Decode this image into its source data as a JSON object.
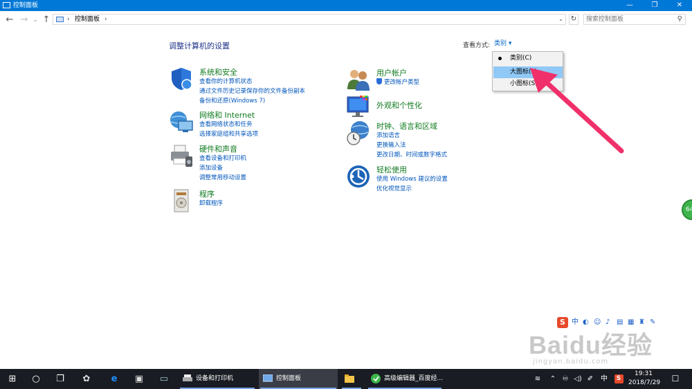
{
  "window": {
    "title": "控制面板",
    "minimize_glyph": "—",
    "maximize_glyph": "❐",
    "close_glyph": "✕"
  },
  "addressbar": {
    "back_glyph": "←",
    "forward_glyph": "→",
    "recent_glyph": "⌄",
    "up_glyph": "↑",
    "crumb": "控制面板",
    "sep_glyph": "›",
    "dropdown_glyph": "⌄",
    "refresh_glyph": "↻",
    "search_placeholder": "搜索控制面板",
    "search_glyph": "⚲"
  },
  "main": {
    "heading": "调整计算机的设置",
    "view_by_label": "查看方式:",
    "view_by_value": "类别",
    "view_by_glyph": "▾"
  },
  "view_menu": {
    "items": [
      {
        "label": "类别(C)",
        "selected": true
      },
      {
        "label": "大图标(L)",
        "highlighted": true
      },
      {
        "label": "小图标(S)"
      }
    ]
  },
  "categories": [
    {
      "title": "系统和安全",
      "icon": "shield-icon",
      "links": [
        "查看你的计算机状态",
        "通过文件历史记录保存你的文件备份副本",
        "备份和还原(Windows 7)"
      ]
    },
    {
      "title": "网络和 Internet",
      "icon": "globe-network-icon",
      "links": [
        "查看网络状态和任务",
        "选择家庭组和共享选项"
      ]
    },
    {
      "title": "硬件和声音",
      "icon": "printer-icon",
      "links": [
        "查看设备和打印机",
        "添加设备",
        "调整常用移动设置"
      ]
    },
    {
      "title": "程序",
      "icon": "programs-icon",
      "links": [
        "卸载程序"
      ]
    },
    {
      "title": "用户帐户",
      "icon": "users-icon",
      "links": [
        "更改帐户类型"
      ]
    },
    {
      "title": "外观和个性化",
      "icon": "appearance-icon",
      "links": []
    },
    {
      "title": "时钟、语言和区域",
      "icon": "clock-globe-icon",
      "links": [
        "添加语言",
        "更换输入法",
        "更改日期、时间或数字格式"
      ]
    },
    {
      "title": "轻松使用",
      "icon": "ease-of-access-icon",
      "links": [
        "使用 Windows 建议的设置",
        "优化视觉显示"
      ]
    }
  ],
  "ime_toolbar": {
    "logo": "S",
    "lang": "中",
    "icons": [
      "moon-icon",
      "smile-icon",
      "mic-icon",
      "keyboard-icon",
      "grid-icon",
      "shirt-icon",
      "wrench-icon"
    ]
  },
  "watermark": {
    "line1": "Baidu经验",
    "line2": "jingyan.baidu.com"
  },
  "side_widget": {
    "text": "64"
  },
  "taskbar": {
    "start_glyph": "⊞",
    "search_glyph": "○",
    "taskview_glyph": "❐",
    "tasks": [
      {
        "label": "设备和打印机",
        "active": false
      },
      {
        "label": "控制面板",
        "active": true
      },
      {
        "label": "",
        "active": false
      },
      {
        "label": "高级编辑器_百度经...",
        "active": false
      }
    ],
    "tray": {
      "wifi_glyph": "≋",
      "up_glyph": "⌃",
      "volume_glyph": "🔈",
      "lang": "中",
      "time": "19:31",
      "date": "2018/7/29",
      "notify_glyph": "☐"
    }
  },
  "colors": {
    "titlebar": "#0078d7",
    "category_title": "#0f7a1e",
    "link": "#0055bb",
    "heading": "#1e3287",
    "menu_highlight": "#90c8f6",
    "arrow": "#f0306a",
    "taskbar": "#1a1c24"
  }
}
